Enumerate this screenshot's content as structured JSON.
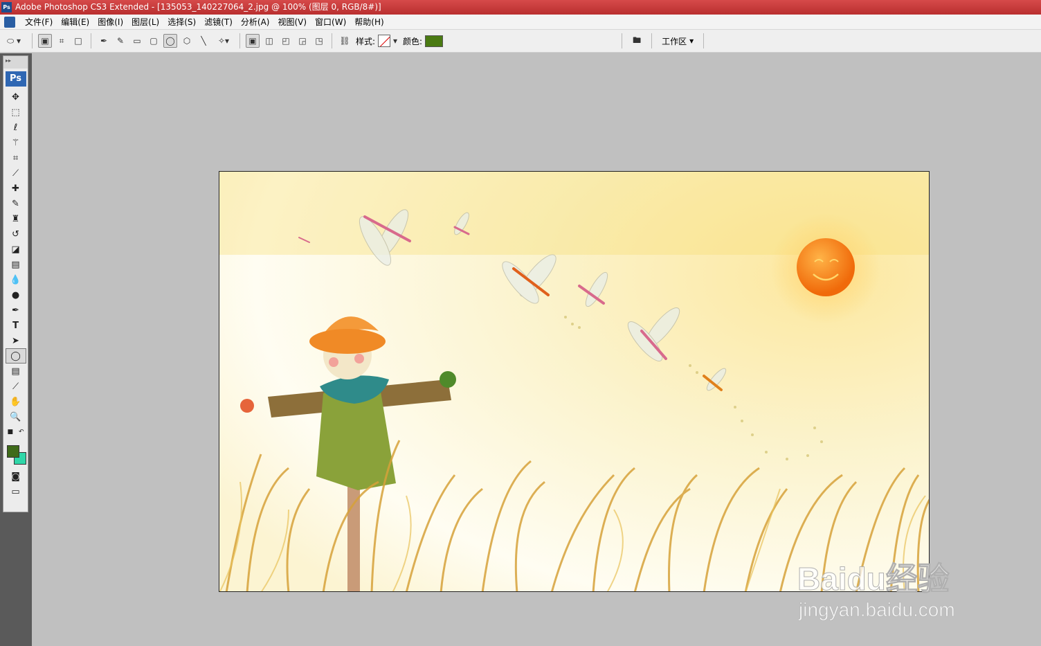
{
  "window": {
    "title": "Adobe Photoshop CS3 Extended - [135053_140227064_2.jpg @ 100% (图层 0, RGB/8#)]",
    "app_badge": "Ps"
  },
  "menu": {
    "items": [
      "文件(F)",
      "编辑(E)",
      "图像(I)",
      "图层(L)",
      "选择(S)",
      "滤镜(T)",
      "分析(A)",
      "视图(V)",
      "窗口(W)",
      "帮助(H)"
    ]
  },
  "options": {
    "style_label": "样式:",
    "color_label": "颜色:",
    "workspace_label": "工作区",
    "color_value": "#4a7a12"
  },
  "toolbox": {
    "badge": "Ps",
    "foreground_color": "#3f6b1a",
    "background_color": "#2fd6a8",
    "active_tool": "ellipse-tool"
  },
  "watermark": {
    "brand": "Baidu经验",
    "url": "jingyan.baidu.com"
  }
}
